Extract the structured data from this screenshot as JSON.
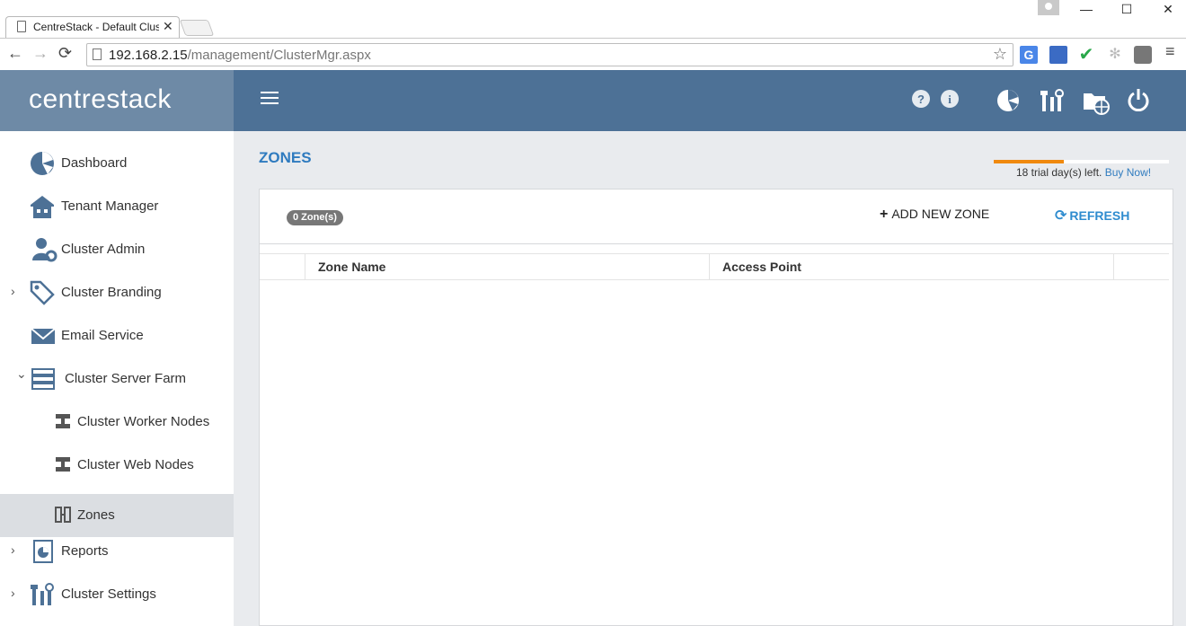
{
  "browser": {
    "tab_title": "CentreStack - Default Clus",
    "tab_close": "✕",
    "url_host": "192.168.2.15",
    "url_path": "/management/ClusterMgr.aspx",
    "window_controls": {
      "minimize": "—",
      "maximize": "☐",
      "close": "✕"
    },
    "nav": {
      "back": "←",
      "forward": "→",
      "reload": "⟳",
      "star": "☆",
      "menu": "≡"
    },
    "extensions": [
      "google-translate-icon",
      "calendar-ext-icon",
      "checkmark-ext-icon",
      "snowflake-ext-icon",
      "box-ext-icon"
    ]
  },
  "header": {
    "brand": "centrestack",
    "icons": [
      "help-icon",
      "info-icon",
      "dashboard-pie-icon",
      "tools-icon",
      "folder-globe-icon",
      "power-icon"
    ]
  },
  "sidebar": {
    "items": [
      {
        "label": "Dashboard",
        "icon": "pie-chart-icon",
        "expandable": false
      },
      {
        "label": "Tenant Manager",
        "icon": "building-icon",
        "expandable": false
      },
      {
        "label": "Cluster Admin",
        "icon": "user-gear-icon",
        "expandable": false
      },
      {
        "label": "Cluster Branding",
        "icon": "tags-icon",
        "expandable": true,
        "chevron": "›"
      },
      {
        "label": "Email Service",
        "icon": "envelope-icon",
        "expandable": false
      },
      {
        "label": "Cluster Server Farm",
        "icon": "server-stack-icon",
        "expandable": true,
        "chevron": "⌄"
      },
      {
        "label": "Cluster Worker Nodes",
        "icon": "node-icon",
        "sub": true
      },
      {
        "label": "Cluster Web Nodes",
        "icon": "node-icon",
        "sub": true
      },
      {
        "label": "Zones",
        "icon": "zones-icon",
        "sub": true,
        "active": true
      },
      {
        "label": "Reports",
        "icon": "report-icon",
        "expandable": true,
        "chevron": "›"
      },
      {
        "label": "Cluster Settings",
        "icon": "tools-icon",
        "expandable": true,
        "chevron": "›"
      }
    ]
  },
  "main": {
    "title": "ZONES",
    "trial": {
      "text": "18 trial day(s) left.",
      "link": "Buy Now!",
      "progress": 0.4,
      "accent": "#f0890e"
    },
    "zone_count": "0 Zone(s)",
    "add_zone": "ADD NEW ZONE",
    "refresh": "REFRESH",
    "columns": [
      "",
      "Zone Name",
      "Access Point",
      ""
    ]
  },
  "colors": {
    "header": "#4d7196",
    "brand_bg": "#6e8aa6",
    "accent_blue": "#2f7bbf",
    "active_nav": "#dbdee2"
  }
}
